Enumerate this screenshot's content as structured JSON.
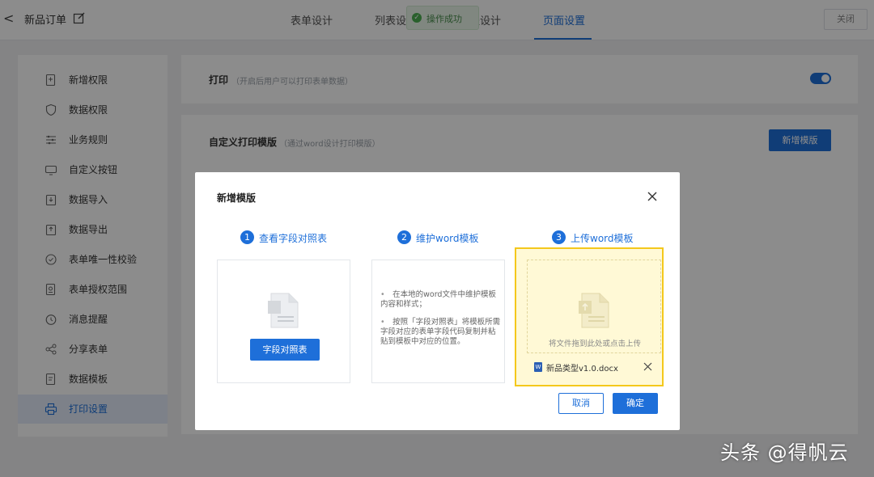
{
  "header": {
    "back_glyph": "<",
    "title": "新品订单",
    "tabs": [
      {
        "label": "表单设计"
      },
      {
        "label": "列表设计"
      },
      {
        "label": "流程设计"
      },
      {
        "label": "页面设置"
      }
    ],
    "active_tab": "页面设置",
    "toast": "操作成功",
    "close_label": "关闭"
  },
  "sidebar": {
    "items": [
      {
        "label": "新增权限",
        "icon": "add-permission-icon"
      },
      {
        "label": "数据权限",
        "icon": "shield-icon"
      },
      {
        "label": "业务规则",
        "icon": "rules-icon"
      },
      {
        "label": "自定义按钮",
        "icon": "custom-button-icon"
      },
      {
        "label": "数据导入",
        "icon": "import-icon"
      },
      {
        "label": "数据导出",
        "icon": "export-icon"
      },
      {
        "label": "表单唯一性校验",
        "icon": "unique-check-icon"
      },
      {
        "label": "表单授权范围",
        "icon": "auth-scope-icon"
      },
      {
        "label": "消息提醒",
        "icon": "clock-icon"
      },
      {
        "label": "分享表单",
        "icon": "share-icon"
      },
      {
        "label": "数据模板",
        "icon": "data-template-icon"
      },
      {
        "label": "打印设置",
        "icon": "printer-icon"
      }
    ],
    "active_index": 11
  },
  "print_section": {
    "title": "打印",
    "desc": "（开启后用户可以打印表单数据）",
    "enabled": true
  },
  "custom_template_section": {
    "title": "自定义打印模版",
    "desc": "（通过word设计打印模版）",
    "add_button": "新增模版"
  },
  "modal": {
    "title": "新增模版",
    "steps": [
      {
        "num": "1",
        "label": "查看字段对照表"
      },
      {
        "num": "2",
        "label": "维护word模板"
      },
      {
        "num": "3",
        "label": "上传word模板"
      }
    ],
    "field_map_button": "字段对照表",
    "notes": [
      "在本地的word文件中维护模板内容和样式；",
      "按照「字段对照表」将模板所需字段对应的表单字段代码复制并粘贴到模板中对应的位置。"
    ],
    "upload_hint": "将文件拖到此处或点击上传",
    "file_name": "新品类型v1.0.docx",
    "cancel_label": "取消",
    "ok_label": "确定"
  },
  "watermark": "头条 @得帆云",
  "colors": {
    "accent": "#1e6fd9",
    "highlight_border": "#f4c81c"
  }
}
